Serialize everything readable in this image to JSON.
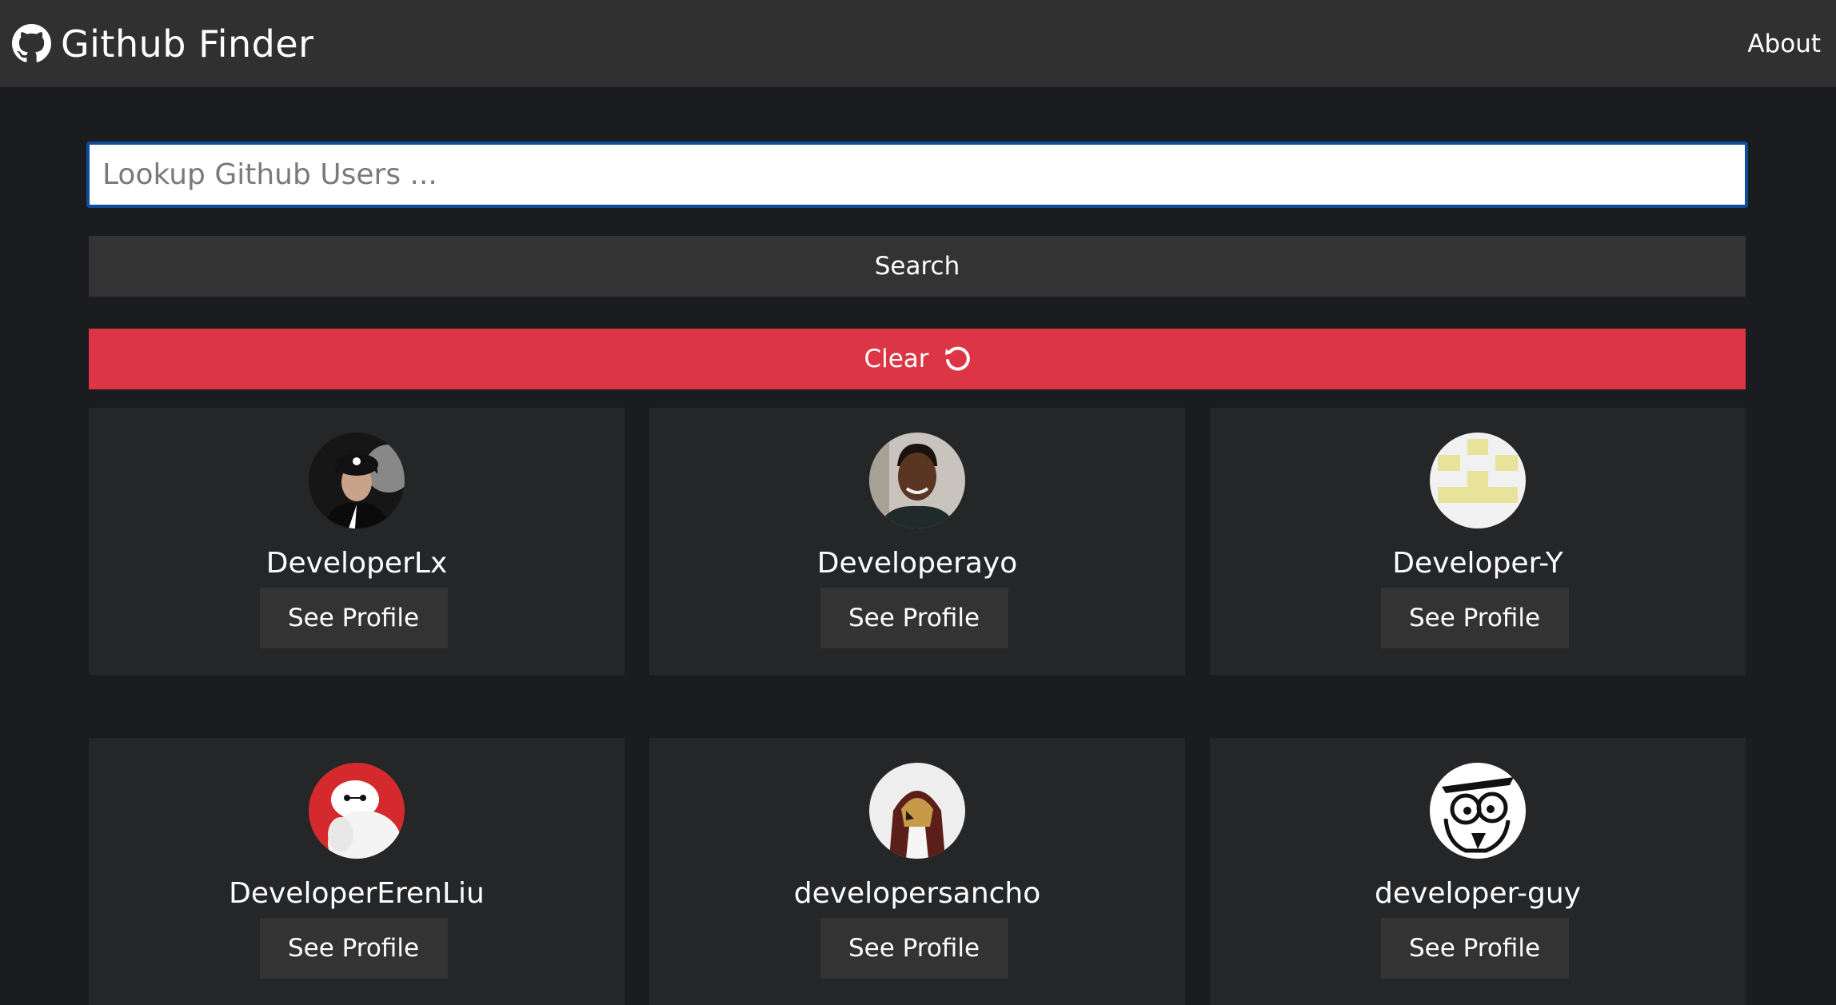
{
  "navbar": {
    "brand_icon": "github-icon",
    "title": "Github Finder",
    "about_label": "About"
  },
  "search": {
    "placeholder": "Lookup Github Users ...",
    "value": "",
    "button_label": "Search"
  },
  "clear": {
    "label": "Clear",
    "icon": "undo-icon"
  },
  "colors": {
    "background": "#1b1c1f",
    "navbar": "#303030",
    "card": "#252628",
    "button": "#333333",
    "clear": "#dc3545",
    "input_border": "#0f4c9c"
  },
  "users": [
    {
      "login": "DeveloperLx",
      "button": "See Profile",
      "avatar": "avatar-photo-man-black-cap"
    },
    {
      "login": "Developerayo",
      "button": "See Profile",
      "avatar": "avatar-photo-smiling-man"
    },
    {
      "login": "Developer-Y",
      "button": "See Profile",
      "avatar": "avatar-identicon-yellow"
    },
    {
      "login": "DeveloperErenLiu",
      "button": "See Profile",
      "avatar": "avatar-baymax"
    },
    {
      "login": "developersancho",
      "button": "See Profile",
      "avatar": "avatar-assassin-character"
    },
    {
      "login": "developer-guy",
      "button": "See Profile",
      "avatar": "avatar-cartoon-glasses"
    }
  ]
}
